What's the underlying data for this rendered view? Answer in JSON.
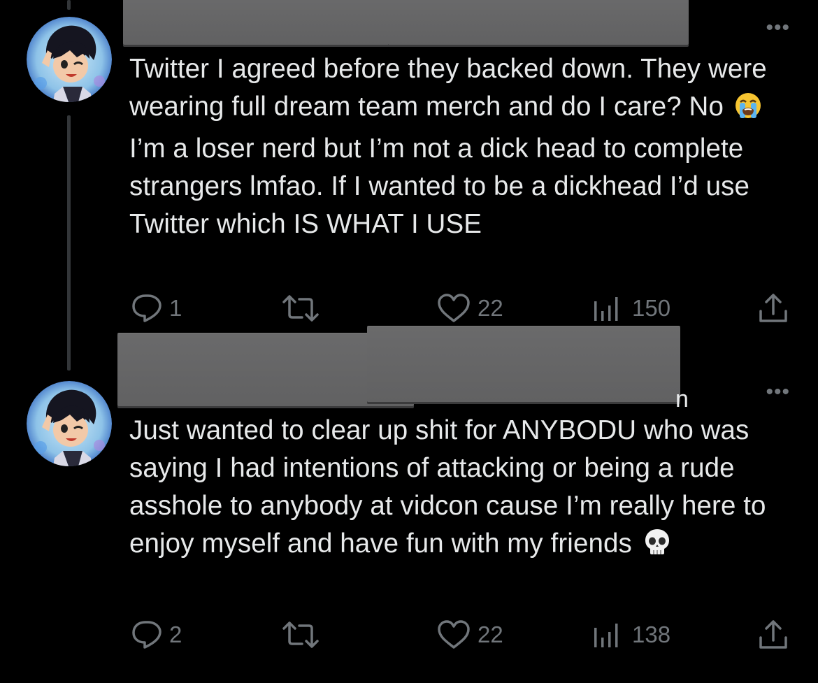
{
  "tweets": [
    {
      "text_before_emoji": "Twitter I agreed before they backed down. They were wearing full dream team merch and do I care? No ",
      "emoji": "loudly-crying-face",
      "text_after_emoji": " I’m a loser nerd but I’m not a dick head to complete strangers lmfao. If I wanted to be a dickhead I’d use Twitter which IS WHAT I USE",
      "replies": "1",
      "likes": "22",
      "views": "150"
    },
    {
      "text_before_emoji": "Just wanted to clear up shit for ANYBODU who was saying I had intentions of attacking or being a rude asshole to anybody at vidcon cause I’m really here to enjoy myself and have fun with my friends ",
      "emoji": "skull",
      "text_after_emoji": "",
      "replies": "2",
      "likes": "22",
      "views": "138"
    }
  ],
  "partial_header_char": "n",
  "more_glyph": "•••",
  "colors": {
    "background": "#000000",
    "text": "#e7e9ea",
    "secondary": "#71767b",
    "redaction": "#666667"
  }
}
